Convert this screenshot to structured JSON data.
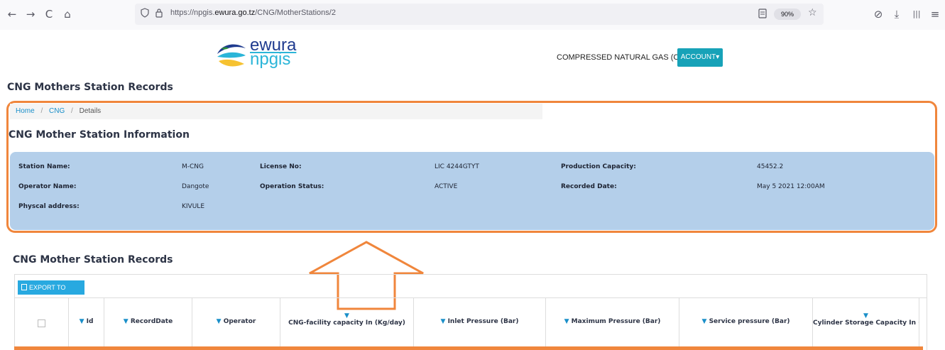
{
  "browser": {
    "back": "←",
    "forward": "→",
    "reload": "C",
    "home": "⌂",
    "shield_icon": "shield-icon",
    "lock_icon": "lock-icon",
    "url_prefix": "https://npgis.",
    "url_host": "ewura.go.tz",
    "url_path": "/CNG/MotherStations/2",
    "zoom": "90%",
    "star": "☆",
    "pocket": "⊘",
    "download": "⤓",
    "library": "|||",
    "menu": "≡"
  },
  "header": {
    "logo_line1": "ewura",
    "logo_line2": "npgis",
    "nav_cng": "COMPRESSED NATURAL GAS (CNG)",
    "account": "ACCOUNT▾"
  },
  "page": {
    "heading": "CNG Mothers Station Records"
  },
  "breadcrumb": {
    "home": "Home",
    "cng": "CNG",
    "details": "Details",
    "separator": "/"
  },
  "info": {
    "title": "CNG Mother Station Information",
    "station_name_label": "Station Name:",
    "station_name_value": "M-CNG",
    "license_label": "License No:",
    "license_value": "LIC 4244GTYT",
    "capacity_label": "Production Capacity:",
    "capacity_value": "45452.2",
    "operator_label": "Operator Name:",
    "operator_value": "Dangote",
    "status_label": "Operation Status:",
    "status_value": "ACTIVE",
    "recorded_label": "Recorded Date:",
    "recorded_value": "May 5 2021 12:00AM",
    "address_label": "Physcal address:",
    "address_value": "KIVULE"
  },
  "records": {
    "title": "CNG Mother Station Records",
    "export_label": "EXPORT TO EXCEL",
    "columns": [
      "Id",
      "RecordDate",
      "Operator",
      "CNG-facility capacity In (Kg/day)",
      "Inlet Pressure (Bar)",
      "Maximum Pressure (Bar)",
      "Service pressure (Bar)",
      "Cylinder Storage Capacity In (K"
    ]
  },
  "colors": {
    "highlight": "#f0863c",
    "info_panel": "#b4cfea",
    "accent": "#17a2b8",
    "export": "#28a9e0"
  }
}
